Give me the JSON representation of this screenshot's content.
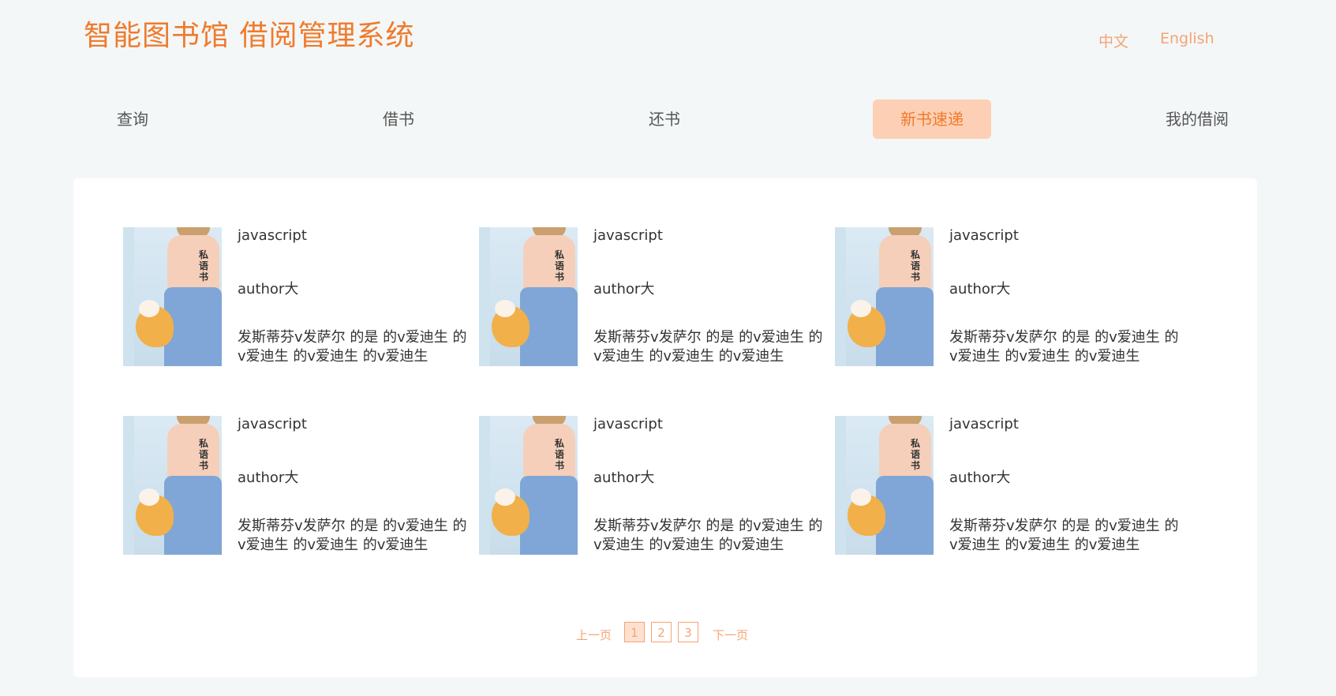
{
  "header": {
    "title": "智能图书馆 借阅管理系统",
    "lang_zh": "中文",
    "lang_en": "English"
  },
  "nav": {
    "items": [
      {
        "label": "查询"
      },
      {
        "label": "借书"
      },
      {
        "label": "还书"
      },
      {
        "label": "新书速递",
        "active": true
      },
      {
        "label": "我的借阅"
      }
    ]
  },
  "books": [
    {
      "cover_title": "私语书",
      "title": "javascript",
      "author": "author大",
      "desc": "发斯蒂芬v发萨尔 的是 的v爱迪生 的v爱迪生 的v爱迪生 的v爱迪生"
    },
    {
      "cover_title": "私语书",
      "title": "javascript",
      "author": "author大",
      "desc": "发斯蒂芬v发萨尔 的是 的v爱迪生 的v爱迪生 的v爱迪生 的v爱迪生"
    },
    {
      "cover_title": "私语书",
      "title": "javascript",
      "author": "author大",
      "desc": "发斯蒂芬v发萨尔 的是 的v爱迪生 的v爱迪生 的v爱迪生 的v爱迪生"
    },
    {
      "cover_title": "私语书",
      "title": "javascript",
      "author": "author大",
      "desc": "发斯蒂芬v发萨尔 的是 的v爱迪生 的v爱迪生 的v爱迪生 的v爱迪生"
    },
    {
      "cover_title": "私语书",
      "title": "javascript",
      "author": "author大",
      "desc": "发斯蒂芬v发萨尔 的是 的v爱迪生 的v爱迪生 的v爱迪生 的v爱迪生"
    },
    {
      "cover_title": "私语书",
      "title": "javascript",
      "author": "author大",
      "desc": "发斯蒂芬v发萨尔 的是 的v爱迪生 的v爱迪生 的v爱迪生 的v爱迪生"
    }
  ],
  "pagination": {
    "prev": "上一页",
    "next": "下一页",
    "pages": [
      "1",
      "2",
      "3"
    ],
    "current": "1"
  },
  "colors": {
    "accent": "#f07a2c",
    "accent_light": "#f5a474",
    "active_bg": "#fdd0b5"
  }
}
